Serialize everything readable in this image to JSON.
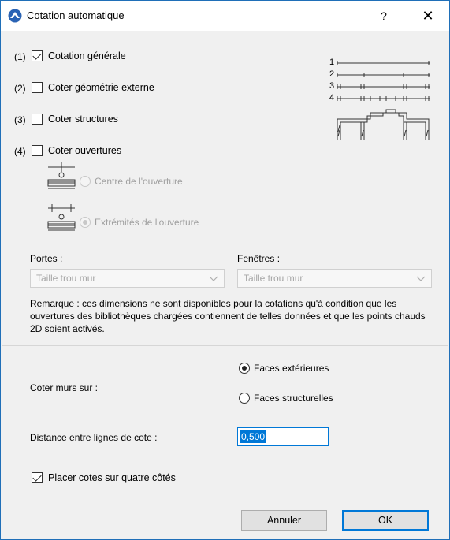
{
  "window": {
    "title": "Cotation automatique",
    "help_label": "?",
    "close_label": "✕"
  },
  "options": [
    {
      "number": "(1)",
      "label": "Cotation générale",
      "checked": true
    },
    {
      "number": "(2)",
      "label": "Coter géométrie externe",
      "checked": false
    },
    {
      "number": "(3)",
      "label": "Coter structures",
      "checked": false
    },
    {
      "number": "(4)",
      "label": "Coter ouvertures",
      "checked": false
    }
  ],
  "preview_numbers": [
    "1",
    "2",
    "3",
    "4"
  ],
  "opening_mode": {
    "center_label": "Centre de l'ouverture",
    "ends_label": "Extrémités de l'ouverture",
    "selected": "ends"
  },
  "doors": {
    "label": "Portes :",
    "value": "Taille trou mur"
  },
  "windows": {
    "label": "Fenêtres :",
    "value": "Taille trou mur"
  },
  "remark": "Remarque : ces dimensions ne sont disponibles pour la cotations qu'à condition que les ouvertures des bibliothèques chargées contiennent de telles données et que les points chauds 2D soient activés.",
  "walls": {
    "label": "Coter murs sur :",
    "option_exterior": "Faces extérieures",
    "option_structural": "Faces structurelles",
    "selected": "exterior"
  },
  "distance": {
    "label": "Distance entre lignes de cote :",
    "value": "0,500"
  },
  "four_sides": {
    "label": "Placer cotes sur quatre côtés",
    "checked": true
  },
  "buttons": {
    "cancel": "Annuler",
    "ok": "OK"
  },
  "colors": {
    "accent": "#0078d7",
    "border": "#1f6fb8"
  }
}
